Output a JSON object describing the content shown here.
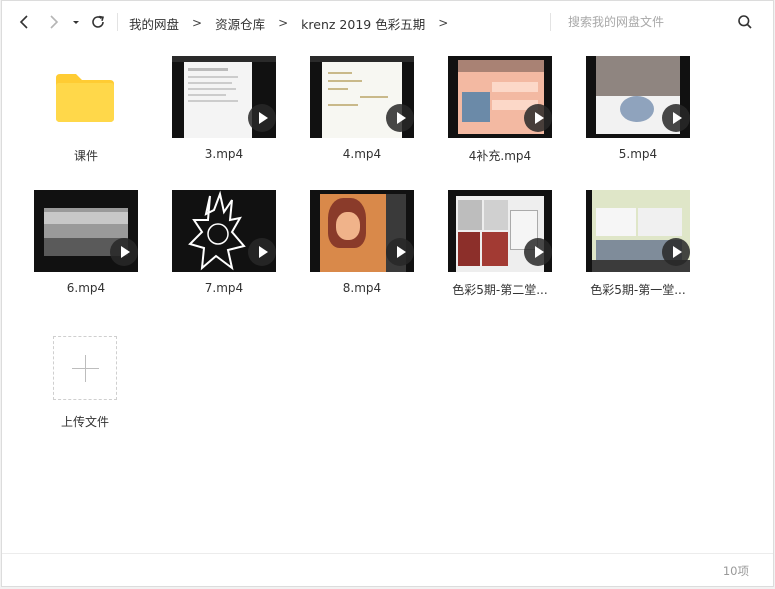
{
  "breadcrumb": [
    "我的网盘",
    "资源仓库",
    "krenz 2019 色彩五期"
  ],
  "breadcrumb_sep": ">",
  "search": {
    "placeholder": "搜索我的网盘文件"
  },
  "items": [
    {
      "name": "课件",
      "kind": "folder"
    },
    {
      "name": "3.mp4",
      "kind": "video",
      "theme": "doc"
    },
    {
      "name": "4.mp4",
      "kind": "video",
      "theme": "notes"
    },
    {
      "name": "4补充.mp4",
      "kind": "video",
      "theme": "peach"
    },
    {
      "name": "5.mp4",
      "kind": "video",
      "theme": "gray"
    },
    {
      "name": "6.mp4",
      "kind": "video",
      "theme": "landscape"
    },
    {
      "name": "7.mp4",
      "kind": "video",
      "theme": "lineart"
    },
    {
      "name": "8.mp4",
      "kind": "video",
      "theme": "portrait"
    },
    {
      "name": "色彩5期-第二堂...",
      "kind": "video",
      "theme": "collage"
    },
    {
      "name": "色彩5期-第一堂...",
      "kind": "video",
      "theme": "desktop"
    }
  ],
  "upload": {
    "label": "上传文件"
  },
  "status": {
    "count": "10项"
  },
  "colors": {
    "folder": "#ffd84a",
    "thumb_bg": "#111111",
    "play_bg": "#282828"
  }
}
